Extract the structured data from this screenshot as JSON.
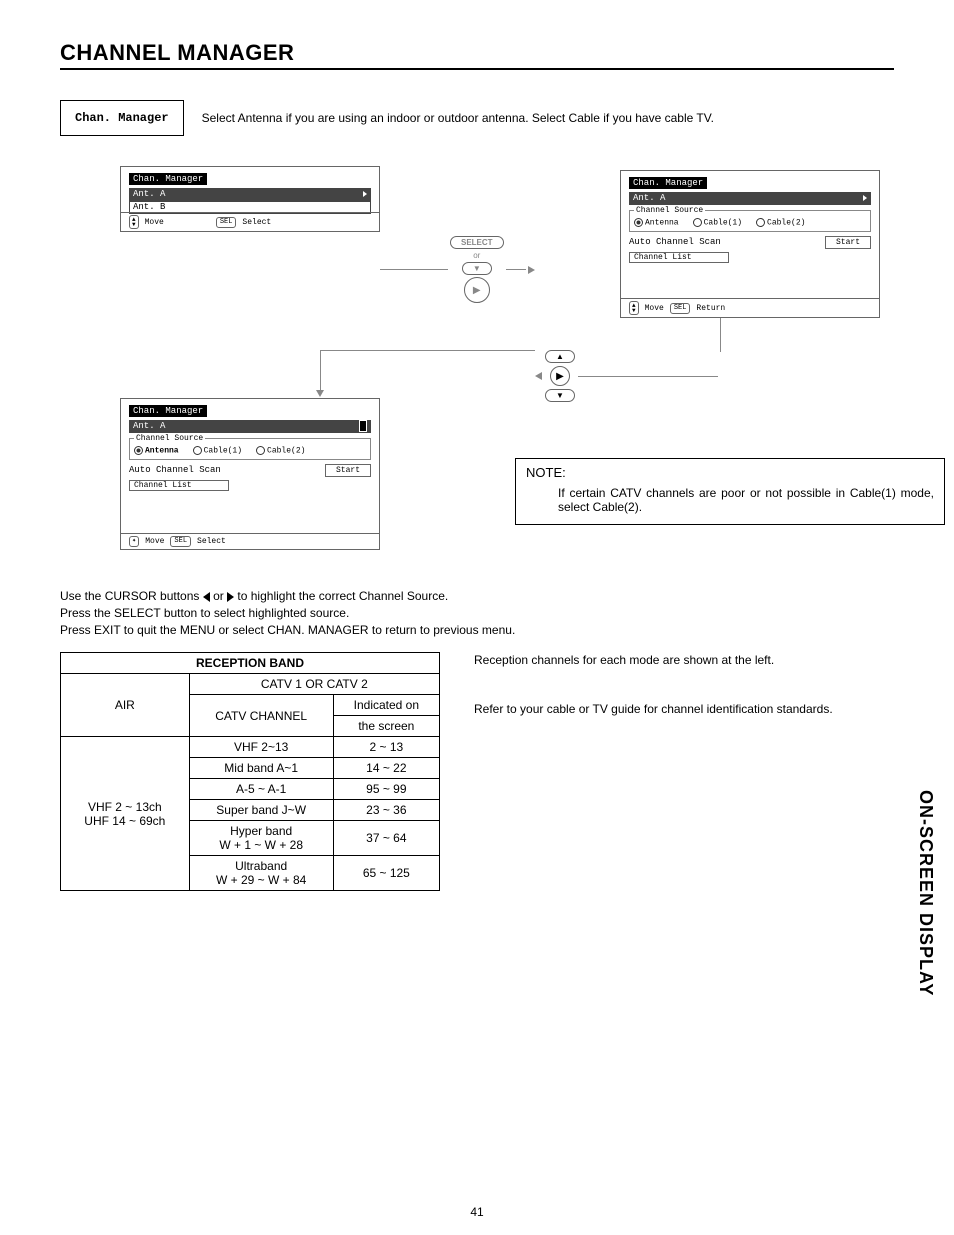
{
  "title": "CHANNEL MANAGER",
  "chan_label": "Chan. Manager",
  "intro": "Select Antenna if you are using an indoor or outdoor antenna.  Select Cable if you have cable TV.",
  "osd": {
    "title": "Chan. Manager",
    "ant_a": "Ant. A",
    "ant_b": "Ant. B",
    "move": "Move",
    "select": "Select",
    "return": "Return",
    "channel_source": "Channel Source",
    "antenna": "Antenna",
    "cable1": "Cable(1)",
    "cable2": "Cable(2)",
    "auto_scan": "Auto Channel Scan",
    "start": "Start",
    "channel_list": "Channel List"
  },
  "flow": {
    "select_btn": "SELECT",
    "or": "or"
  },
  "note": {
    "title": "NOTE:",
    "body": "If certain CATV channels are poor or not possible in Cable(1) mode, select Cable(2)."
  },
  "instructions": {
    "l1a": "Use the CURSOR buttons ",
    "l1b": " or ",
    "l1c": " to highlight the correct Channel Source.",
    "l2": "Press the SELECT button to select highlighted source.",
    "l3": "Press EXIT to quit the MENU or select CHAN. MANAGER to return to previous menu."
  },
  "table": {
    "title": "RECEPTION BAND",
    "air": "AIR",
    "catv_hdr": "CATV 1 OR CATV 2",
    "catv_channel": "CATV CHANNEL",
    "indicated1": "Indicated on",
    "indicated2": "the screen",
    "air_rows": [
      "VHF 2 ~ 13ch",
      "UHF 14 ~ 69ch"
    ],
    "rows": [
      {
        "c": "VHF 2~13",
        "v": "2 ~ 13"
      },
      {
        "c": "Mid band A~1",
        "v": "14 ~ 22"
      },
      {
        "c": "A-5 ~ A-1",
        "v": "95 ~ 99"
      },
      {
        "c": "Super band J~W",
        "v": "23 ~ 36"
      },
      {
        "c": "Hyper band",
        "c2": "W + 1 ~ W + 28",
        "v": "37 ~ 64"
      },
      {
        "c": "Ultraband",
        "c2": "W + 29 ~ W + 84",
        "v": "65 ~ 125"
      }
    ]
  },
  "side_text": {
    "p1": "Reception channels for each mode are shown at the left.",
    "p2": "Refer to your cable or TV guide for channel identification standards."
  },
  "side_label": "ON-SCREEN DISPLAY",
  "page_num": "41"
}
